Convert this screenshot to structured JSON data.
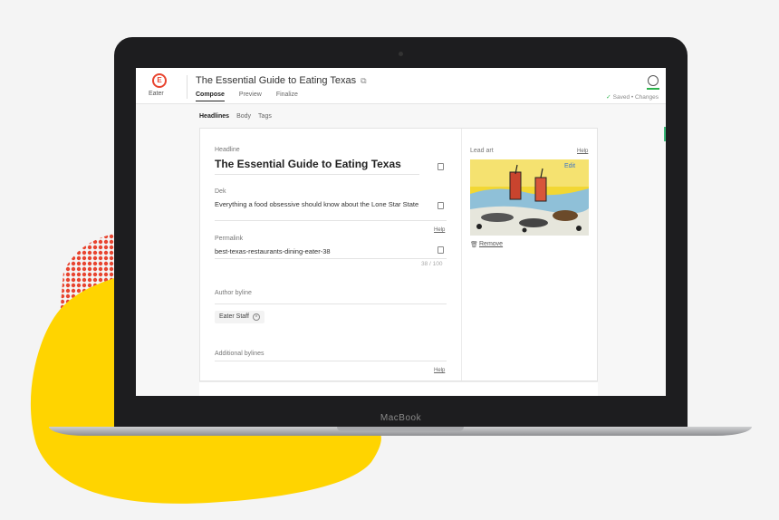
{
  "device": {
    "label": "MacBook"
  },
  "app": {
    "brand": "Eater",
    "logo_letter": "E",
    "title": "The Essential Guide to Eating Texas",
    "tabs": [
      "Compose",
      "Preview",
      "Finalize"
    ],
    "status_saved": "Saved",
    "status_changes": "Changes"
  },
  "subtabs": [
    "Headlines",
    "Body",
    "Tags"
  ],
  "form": {
    "headline_label": "Headline",
    "headline_value": "The Essential Guide to Eating Texas",
    "dek_label": "Dek",
    "dek_value": "Everything a food obsessive should know about the Lone Star State",
    "help_1": "Help",
    "permalink_label": "Permalink",
    "permalink_value": "best-texas-restaurants-dining-eater-38",
    "permalink_counter": "38 / 100",
    "byline_label": "Author byline",
    "byline_chip": "Eater Staff",
    "additional_label": "Additional bylines",
    "help_2": "Help"
  },
  "lead_art": {
    "label": "Lead art",
    "help": "Help",
    "edit": "Edit",
    "remove": "Remove"
  },
  "colors": {
    "accent_green": "#2ab24b",
    "brand_red": "#e8442f",
    "blob_yellow": "#ffd400",
    "dots_red": "#e8442f"
  }
}
